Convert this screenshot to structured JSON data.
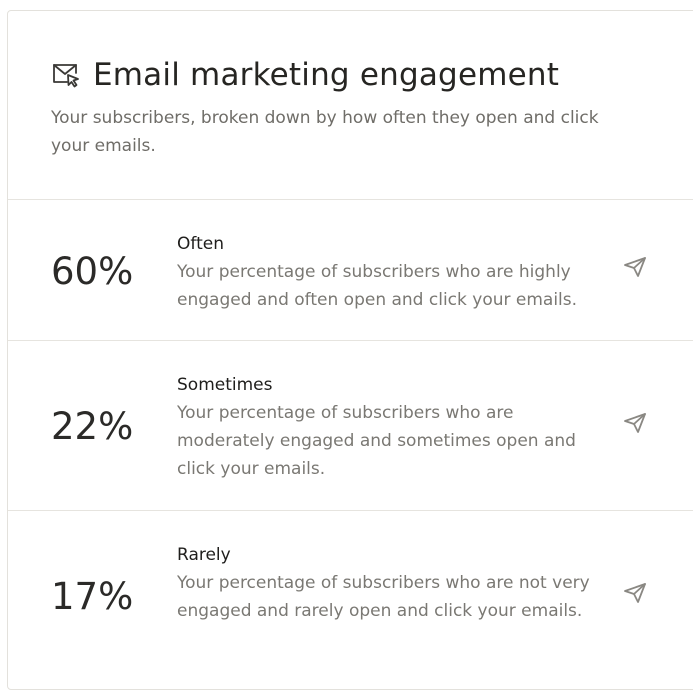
{
  "header": {
    "icon": "mail-cursor-icon",
    "title": "Email marketing engagement",
    "subtitle": "Your subscribers, broken down by how often they open and click your emails."
  },
  "rows": [
    {
      "percent": "60%",
      "label": "Often",
      "description": "Your percentage of subscribers who are highly engaged and often open and click your emails.",
      "icon": "send-icon"
    },
    {
      "percent": "22%",
      "label": "Sometimes",
      "description": "Your percentage of subscribers who are moderately engaged and sometimes open and click your emails.",
      "icon": "send-icon"
    },
    {
      "percent": "17%",
      "label": "Rarely",
      "description": "Your percentage of subscribers who are not very engaged and rarely open and click your emails.",
      "icon": "send-icon"
    }
  ],
  "colors": {
    "text": "#2b2a28",
    "muted": "#7a7873",
    "border": "#e6e4df",
    "icon": "#8a8883"
  }
}
